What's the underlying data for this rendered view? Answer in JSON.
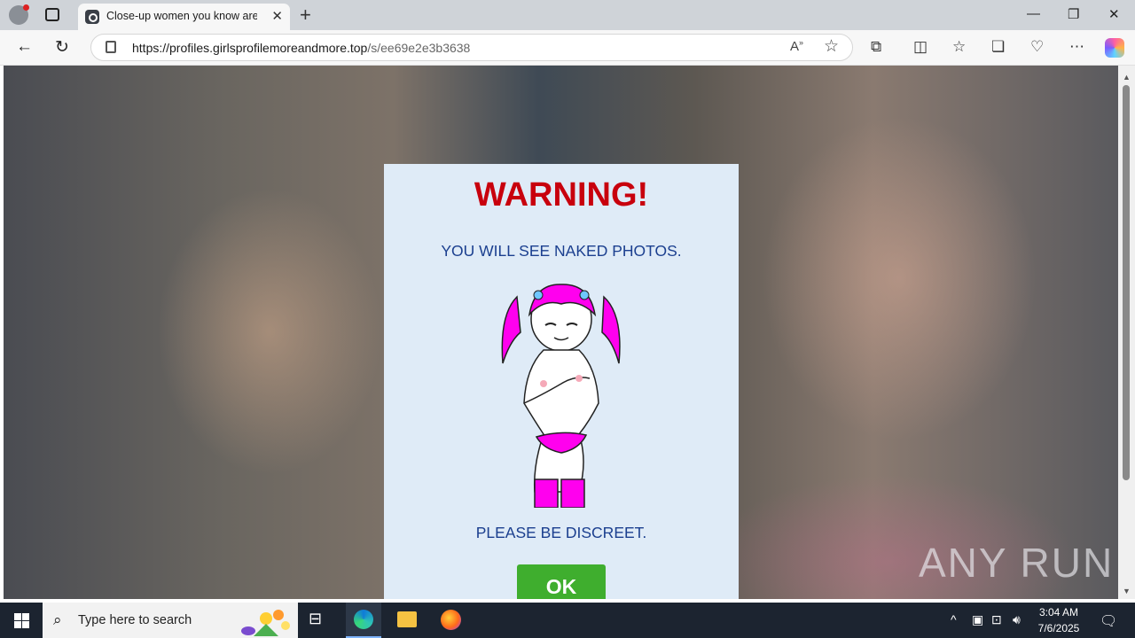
{
  "browser": {
    "tab_title": "Close-up women you know are lo",
    "url_host": "https://profiles.girlsprofilemoreandmore.top",
    "url_path": "/s/ee69e2e3b3638"
  },
  "modal": {
    "title": "WARNING!",
    "line1": "YOU WILL SEE NAKED PHOTOS.",
    "line2": "PLEASE BE DISCREET.",
    "ok_label": "OK"
  },
  "watermark": "ANY RUN",
  "taskbar": {
    "search_placeholder": "Type here to search",
    "time": "3:04 AM",
    "date": "7/6/2025"
  },
  "colors": {
    "warning_red": "#c8000d",
    "text_blue": "#1b3f8f",
    "ok_green": "#3fae2e",
    "modal_bg": "#dfebf7"
  }
}
